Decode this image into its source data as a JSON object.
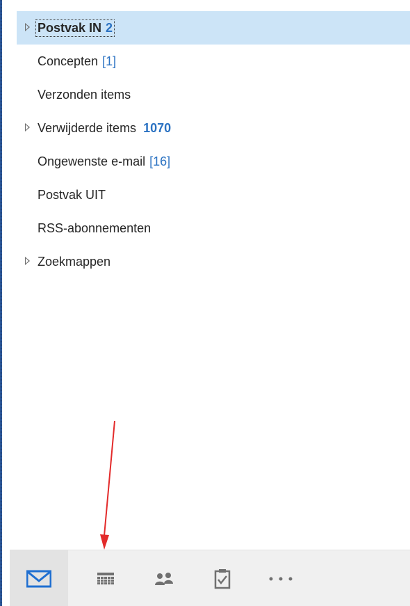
{
  "folders": [
    {
      "name": "Postvak IN",
      "count": "2",
      "expandable": true,
      "selected": true
    },
    {
      "name": "Concepten",
      "count": "[1]",
      "expandable": false
    },
    {
      "name": "Verzonden items",
      "count": "",
      "expandable": false
    },
    {
      "name": "Verwijderde items",
      "count": "1070",
      "expandable": true
    },
    {
      "name": "Ongewenste e-mail",
      "count": "[16]",
      "expandable": false
    },
    {
      "name": "Postvak UIT",
      "count": "",
      "expandable": false
    },
    {
      "name": "RSS-abonnementen",
      "count": "",
      "expandable": false
    },
    {
      "name": "Zoekmappen",
      "count": "",
      "expandable": true
    }
  ],
  "nav": {
    "items": [
      {
        "icon": "mail-icon",
        "active": true
      },
      {
        "icon": "calendar-icon"
      },
      {
        "icon": "people-icon"
      },
      {
        "icon": "tasks-icon"
      },
      {
        "icon": "more-icon"
      }
    ]
  },
  "colors": {
    "accent": "#2b72c2",
    "selected_bg": "#cce4f7",
    "annotation_arrow": "#e32b2b"
  }
}
